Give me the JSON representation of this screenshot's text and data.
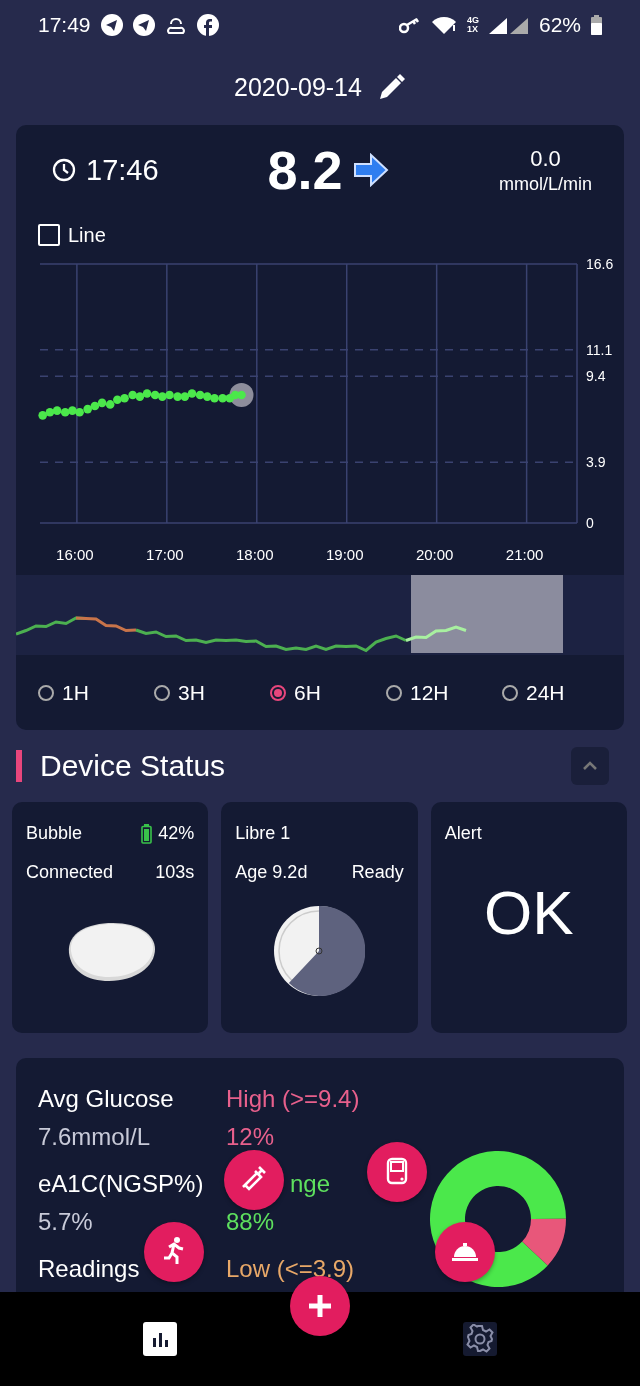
{
  "status_bar": {
    "time": "17:49",
    "network": [
      "4G",
      "1X"
    ],
    "battery": "62%"
  },
  "header": {
    "date": "2020-09-14"
  },
  "current": {
    "time": "17:46",
    "glucose": "8.2",
    "rate": "0.0",
    "rate_unit": "mmol/L/min"
  },
  "line_toggle": {
    "label": "Line",
    "checked": false
  },
  "glucose_chart": {
    "chart_data": {
      "type": "scatter",
      "grid": true,
      "xlim": [
        15.59,
        21.56
      ],
      "ylim": [
        0,
        16.6
      ],
      "x": [
        15.62,
        15.7,
        15.78,
        15.87,
        15.95,
        16.03,
        16.12,
        16.2,
        16.28,
        16.37,
        16.45,
        16.53,
        16.62,
        16.7,
        16.78,
        16.87,
        16.95,
        17.03,
        17.12,
        17.2,
        17.28,
        17.37,
        17.45,
        17.53,
        17.62,
        17.7,
        17.76,
        17.83
      ],
      "xticks": [
        {
          "value": 16,
          "label": "16:00"
        },
        {
          "value": 17,
          "label": "17:00"
        },
        {
          "value": 18,
          "label": "18:00"
        },
        {
          "value": 19,
          "label": "19:00"
        },
        {
          "value": 20,
          "label": "20:00"
        },
        {
          "value": 21,
          "label": "21:00"
        }
      ],
      "yticks": [
        0,
        3.9,
        9.4,
        11.1,
        16.6
      ],
      "series": [
        {
          "color": "#4be84b",
          "values": [
            6.9,
            7.1,
            7.2,
            7.1,
            7.2,
            7.1,
            7.3,
            7.5,
            7.7,
            7.6,
            7.9,
            8.0,
            8.2,
            8.1,
            8.3,
            8.2,
            8.1,
            8.2,
            8.1,
            8.1,
            8.3,
            8.2,
            8.1,
            8.0,
            8.0,
            8.0,
            8.2,
            8.2
          ]
        }
      ]
    }
  },
  "ranges": [
    {
      "label": "1H",
      "selected": false
    },
    {
      "label": "3H",
      "selected": false
    },
    {
      "label": "6H",
      "selected": true
    },
    {
      "label": "12H",
      "selected": false
    },
    {
      "label": "24H",
      "selected": false
    }
  ],
  "device_status": {
    "title": "Device Status",
    "expanded": true,
    "cards": [
      {
        "kind": "transmitter",
        "name": "Bubble",
        "battery": "42%",
        "state": "Connected",
        "reading": "103s"
      },
      {
        "kind": "sensor",
        "name": "Libre 1",
        "age": "Age 9.2d",
        "state": "Ready"
      },
      {
        "kind": "alert",
        "title": "Alert",
        "status": "OK"
      }
    ]
  },
  "stats": {
    "left": [
      {
        "label": "Avg Glucose",
        "value": "7.6mmol/L"
      },
      {
        "label": "eA1C(NGSP%)",
        "value": "5.7%"
      },
      {
        "label": "Readings"
      }
    ],
    "ranges": [
      {
        "label": "High (>=9.4)",
        "value": "12%",
        "color": "#e8608c"
      },
      {
        "label": "nge",
        "value": "88%",
        "color": "#5ee05e"
      },
      {
        "label": "Low (<=3.9)",
        "color": "#e8a868"
      }
    ],
    "chart_data": {
      "type": "donut",
      "values": [
        88,
        12
      ],
      "colors": [
        "#4be84b",
        "#e8577a"
      ]
    }
  },
  "nav": [
    {
      "kind": "statistics",
      "selected": true
    },
    {
      "kind": "settings",
      "selected": false
    }
  ]
}
